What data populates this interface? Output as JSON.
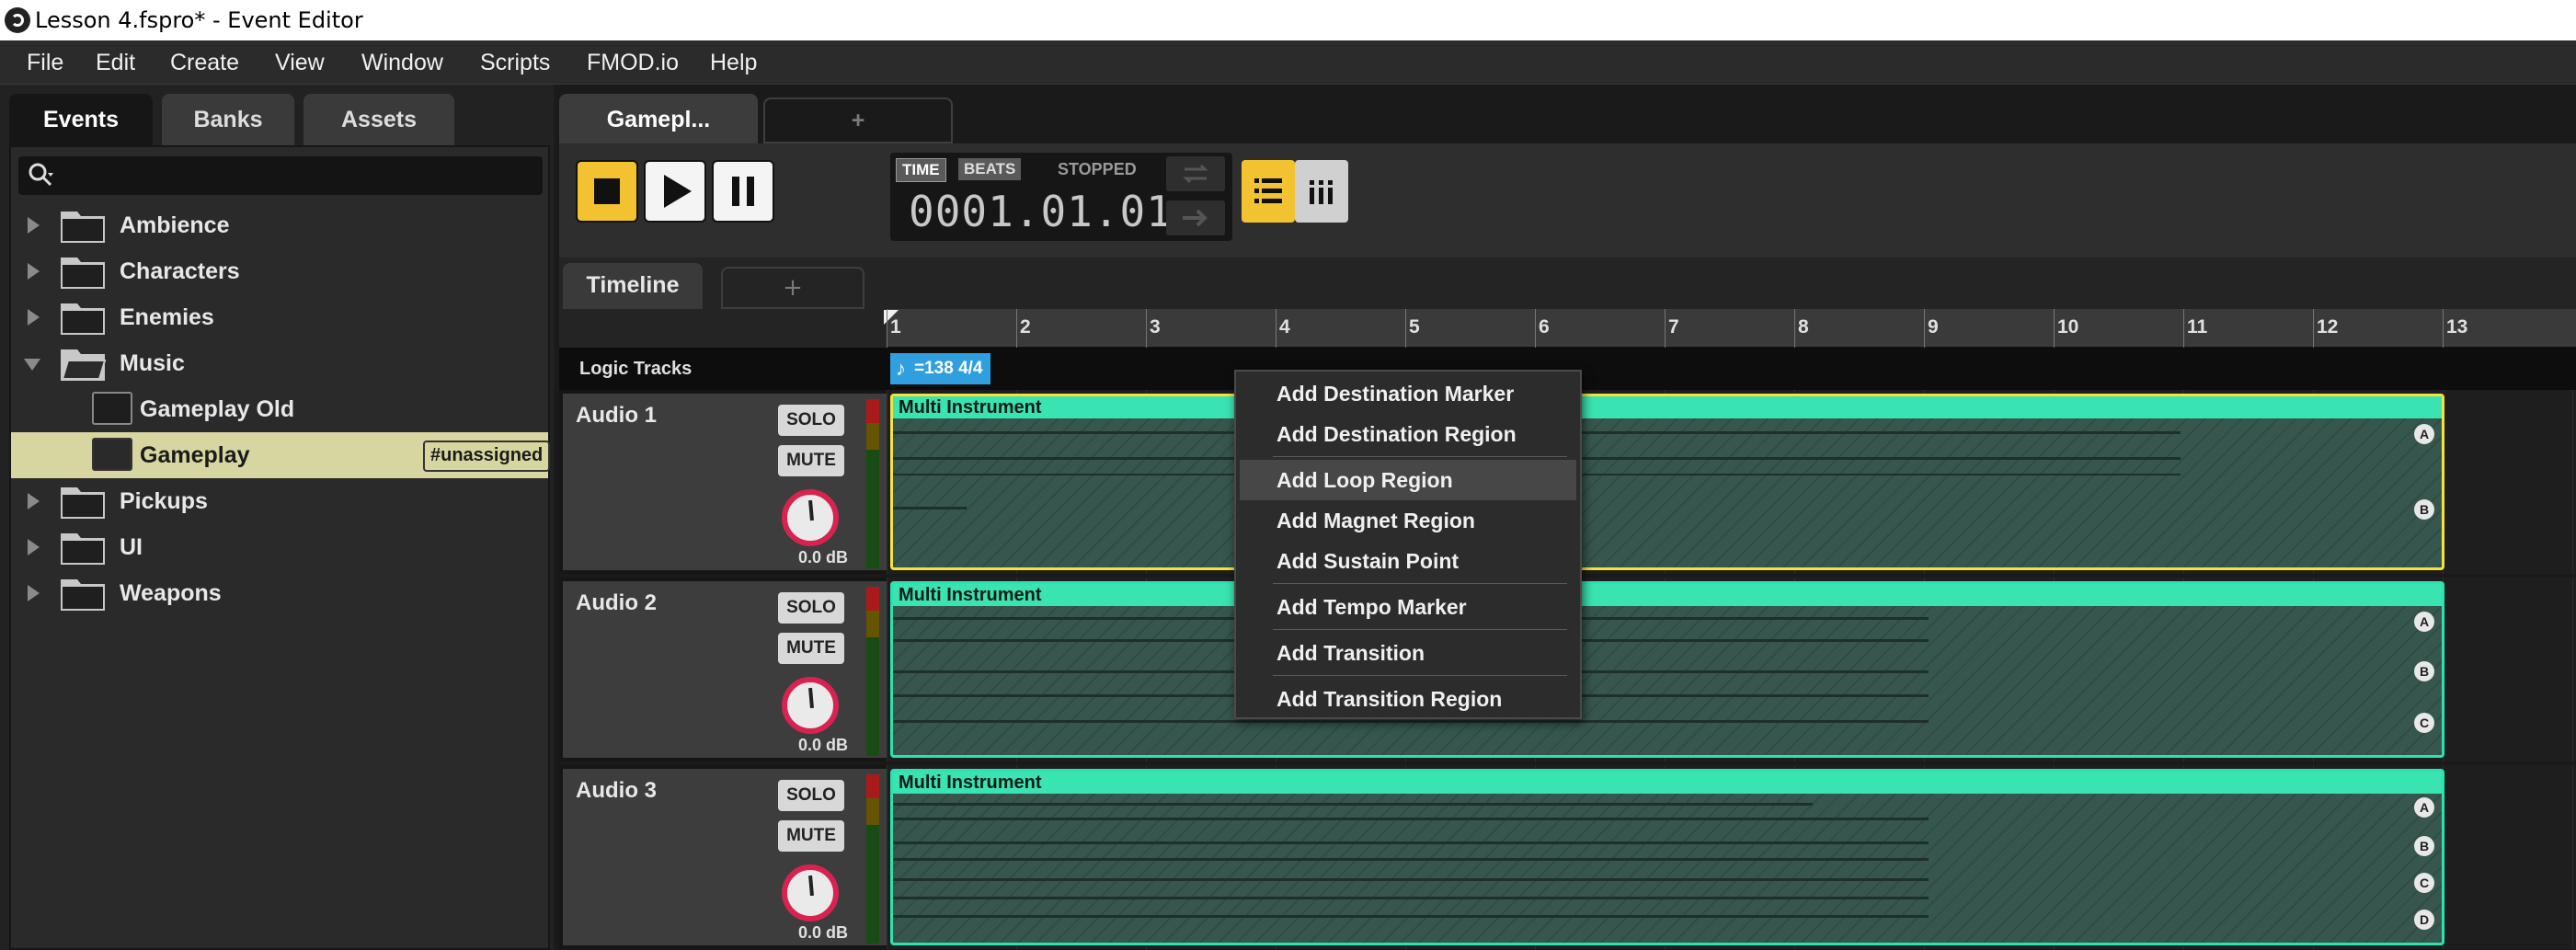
{
  "window": {
    "title": "Lesson 4.fspro* - Event Editor"
  },
  "menu": [
    "File",
    "Edit",
    "Create",
    "View",
    "Window",
    "Scripts",
    "FMOD.io",
    "Help"
  ],
  "browser": {
    "tabs": [
      "Events",
      "Banks",
      "Assets"
    ],
    "active_tab": "Events",
    "search_placeholder": "",
    "items": [
      {
        "label": "Ambience",
        "type": "folder",
        "expanded": false
      },
      {
        "label": "Characters",
        "type": "folder",
        "expanded": false
      },
      {
        "label": "Enemies",
        "type": "folder",
        "expanded": false
      },
      {
        "label": "Music",
        "type": "folder",
        "expanded": true
      },
      {
        "label": "Gameplay Old",
        "type": "event"
      },
      {
        "label": "Gameplay",
        "type": "event",
        "selected": true,
        "badge": "#unassigned"
      },
      {
        "label": "Pickups",
        "type": "folder",
        "expanded": false
      },
      {
        "label": "UI",
        "type": "folder",
        "expanded": false
      },
      {
        "label": "Weapons",
        "type": "folder",
        "expanded": false
      }
    ]
  },
  "editor": {
    "doc_tab": "Gamepl...",
    "add_tab": "+",
    "transport": {
      "time_mode": "TIME",
      "beats_mode": "BEATS",
      "status": "STOPPED",
      "position": "0001.01.01"
    },
    "subtabs": {
      "timeline": "Timeline",
      "add": "+"
    },
    "ruler": [
      "1",
      "2",
      "3",
      "4",
      "5",
      "6",
      "7",
      "8",
      "9",
      "10",
      "11",
      "12",
      "13"
    ],
    "logic_tracks_label": "Logic Tracks",
    "tempo_marker": "=138 4/4",
    "tracks": [
      {
        "name": "Audio 1",
        "solo": "SOLO",
        "mute": "MUTE",
        "volume": "0.0 dB",
        "instrument": "Multi Instrument",
        "lanes": [
          "A",
          "B"
        ]
      },
      {
        "name": "Audio 2",
        "solo": "SOLO",
        "mute": "MUTE",
        "volume": "0.0 dB",
        "instrument": "Multi Instrument",
        "lanes": [
          "A",
          "B",
          "C"
        ]
      },
      {
        "name": "Audio 3",
        "solo": "SOLO",
        "mute": "MUTE",
        "volume": "0.0 dB",
        "instrument": "Multi Instrument",
        "lanes": [
          "A",
          "B",
          "C",
          "D"
        ]
      }
    ]
  },
  "context_menu": {
    "items": [
      "Add Destination Marker",
      "Add Destination Region",
      "Add Loop Region",
      "Add Magnet Region",
      "Add Sustain Point",
      "Add Tempo Marker",
      "Add Transition",
      "Add Transition Region"
    ],
    "highlighted": "Add Loop Region"
  },
  "colors": {
    "accent_yellow": "#f2c230",
    "instrument_green": "#3ae3b2",
    "selected_row": "#d8d6a0",
    "tempo_blue": "#2f9fe0",
    "knob_red": "#d8224f"
  }
}
